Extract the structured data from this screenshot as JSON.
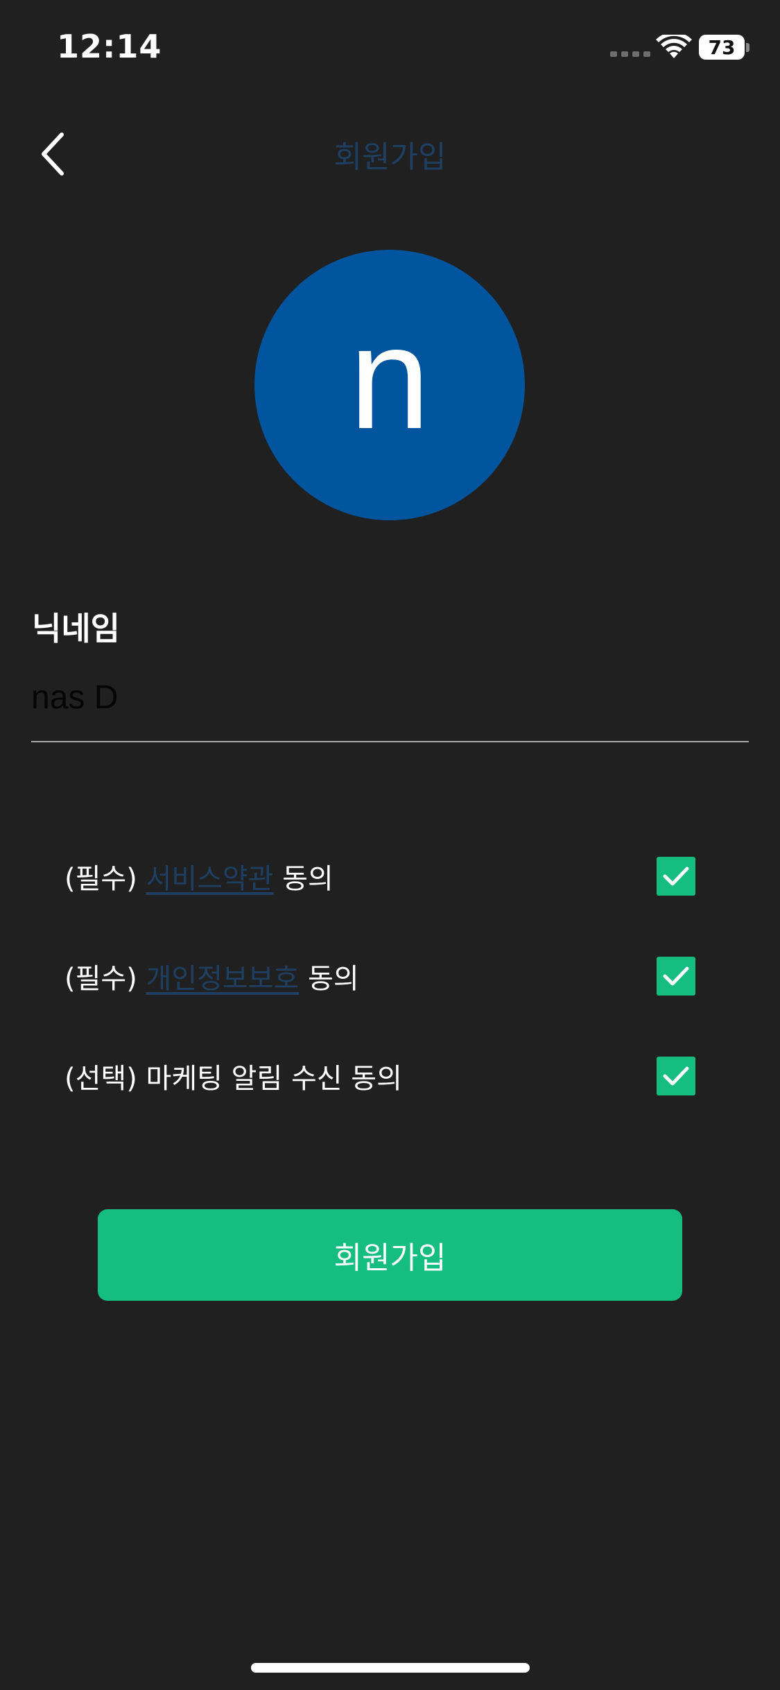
{
  "status_bar": {
    "time": "12:14",
    "battery_level": "73",
    "icons": [
      "signal-dots-icon",
      "wifi-icon",
      "battery-icon"
    ]
  },
  "nav": {
    "title": "회원가입",
    "back_icon": "chevron-left-icon"
  },
  "avatar": {
    "letter": "n",
    "color": "#00559e"
  },
  "nickname": {
    "label": "닉네임",
    "value": "nas D"
  },
  "agreements": [
    {
      "prefix": "(필수) ",
      "link": "서비스약관",
      "suffix": " 동의",
      "checked": true
    },
    {
      "prefix": "(필수) ",
      "link": "개인정보보호",
      "suffix": " 동의",
      "checked": true
    },
    {
      "prefix": "(선택) 마케팅 알림 수신 동의",
      "link": "",
      "suffix": "",
      "checked": true
    }
  ],
  "signup_button": {
    "label": "회원가입"
  },
  "colors": {
    "background": "#202020",
    "accent": "#15be80",
    "link": "#1f3f62"
  }
}
